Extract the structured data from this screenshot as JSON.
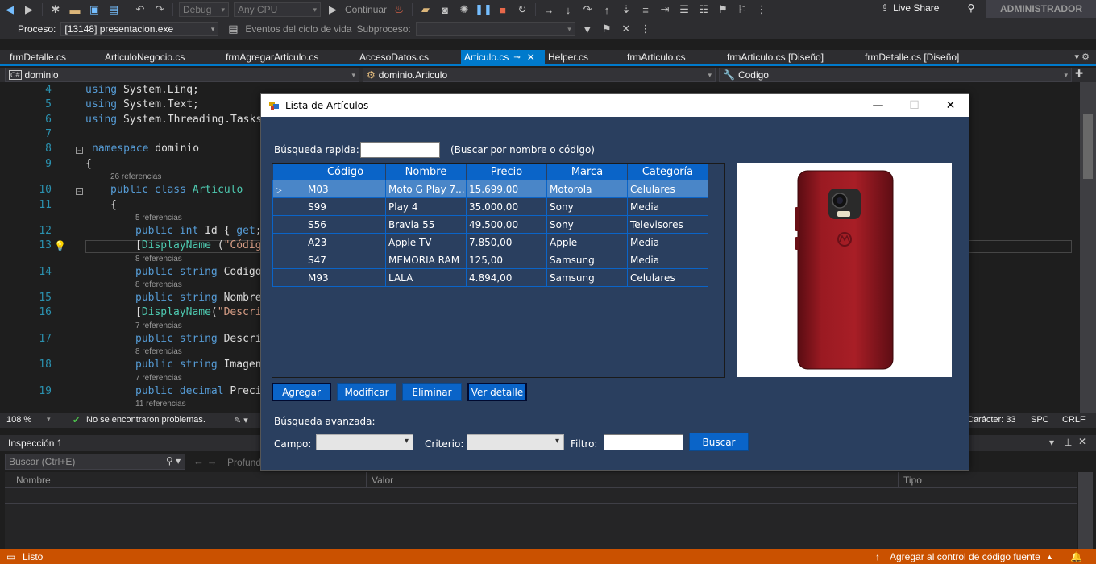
{
  "toolbar": {
    "config": "Debug",
    "platform": "Any CPU",
    "continue": "Continuar",
    "live_share": "Live Share",
    "user": "ADMINISTRADOR"
  },
  "process_bar": {
    "process_label": "Proceso:",
    "process_value": "[13148] presentacion.exe",
    "lifecycle": "Eventos del ciclo de vida",
    "thread_label": "Subproceso:"
  },
  "tabs": [
    {
      "label": "frmDetalle.cs"
    },
    {
      "label": "ArticuloNegocio.cs"
    },
    {
      "label": "frmAgregarArticulo.cs"
    },
    {
      "label": "AccesoDatos.cs"
    },
    {
      "label": "Articulo.cs"
    },
    {
      "label": "Helper.cs"
    },
    {
      "label": "frmArticulo.cs"
    },
    {
      "label": "frmArticulo.cs [Diseño]"
    },
    {
      "label": "frmDetalle.cs [Diseño]"
    }
  ],
  "navbar": {
    "project": "dominio",
    "class": "dominio.Articulo",
    "member": "Codigo"
  },
  "code": {
    "line_numbers": [
      "4",
      "5",
      "6",
      "7",
      "8",
      "9",
      "10",
      "11",
      "12",
      "13",
      "14",
      "15",
      "16",
      "17",
      "18",
      "19"
    ],
    "refs": {
      "r26": "26 referencias",
      "r5": "5 referencias",
      "r8a": "8 referencias",
      "r8b": "8 referencias",
      "r7a": "7 referencias",
      "r8c": "8 referencias",
      "r7b": "7 referencias",
      "r11": "11 referencias"
    }
  },
  "editor_status": {
    "zoom": "108 %",
    "problems": "No se encontraron problemas.",
    "char": "Carácter: 33",
    "spc": "SPC",
    "eol": "CRLF"
  },
  "inspection": {
    "title": "Inspección 1",
    "search_placeholder": "Buscar (Ctrl+E)",
    "depth": "Profund",
    "col_name": "Nombre",
    "col_value": "Valor",
    "col_type": "Tipo"
  },
  "statusbar": {
    "ready": "Listo",
    "source_control": "Agregar al control de código fuente"
  },
  "dialog": {
    "title": "Lista de Artículos",
    "quick_search_label": "Búsqueda rapida:",
    "quick_search_hint": "(Buscar por nombre o código)",
    "columns": [
      "Código",
      "Nombre",
      "Precio",
      "Marca",
      "Categoría"
    ],
    "rows": [
      {
        "codigo": "M03",
        "nombre": "Moto G Play 7...",
        "precio": "15.699,00",
        "marca": "Motorola",
        "categoria": "Celulares",
        "selected": true
      },
      {
        "codigo": "S99",
        "nombre": "Play 4",
        "precio": "35.000,00",
        "marca": "Sony",
        "categoria": "Media"
      },
      {
        "codigo": "S56",
        "nombre": "Bravia 55",
        "precio": "49.500,00",
        "marca": "Sony",
        "categoria": "Televisores"
      },
      {
        "codigo": "A23",
        "nombre": "Apple TV",
        "precio": "7.850,00",
        "marca": "Apple",
        "categoria": "Media"
      },
      {
        "codigo": "S47",
        "nombre": "MEMORIA RAM",
        "precio": "125,00",
        "marca": "Samsung",
        "categoria": "Media"
      },
      {
        "codigo": "M93",
        "nombre": "LALA",
        "precio": "4.894,00",
        "marca": "Samsung",
        "categoria": "Celulares"
      }
    ],
    "buttons": {
      "add": "Agregar",
      "edit": "Modificar",
      "delete": "Eliminar",
      "detail": "Ver detalle",
      "search": "Buscar"
    },
    "advanced_label": "Búsqueda avanzada:",
    "field_label": "Campo:",
    "criteria_label": "Criterio:",
    "filter_label": "Filtro:"
  },
  "colors": {
    "accent": "#007acc",
    "dialog_bg": "#2a3f5f",
    "grid_header": "#0a64c8",
    "status_bar": "#ca5100"
  }
}
